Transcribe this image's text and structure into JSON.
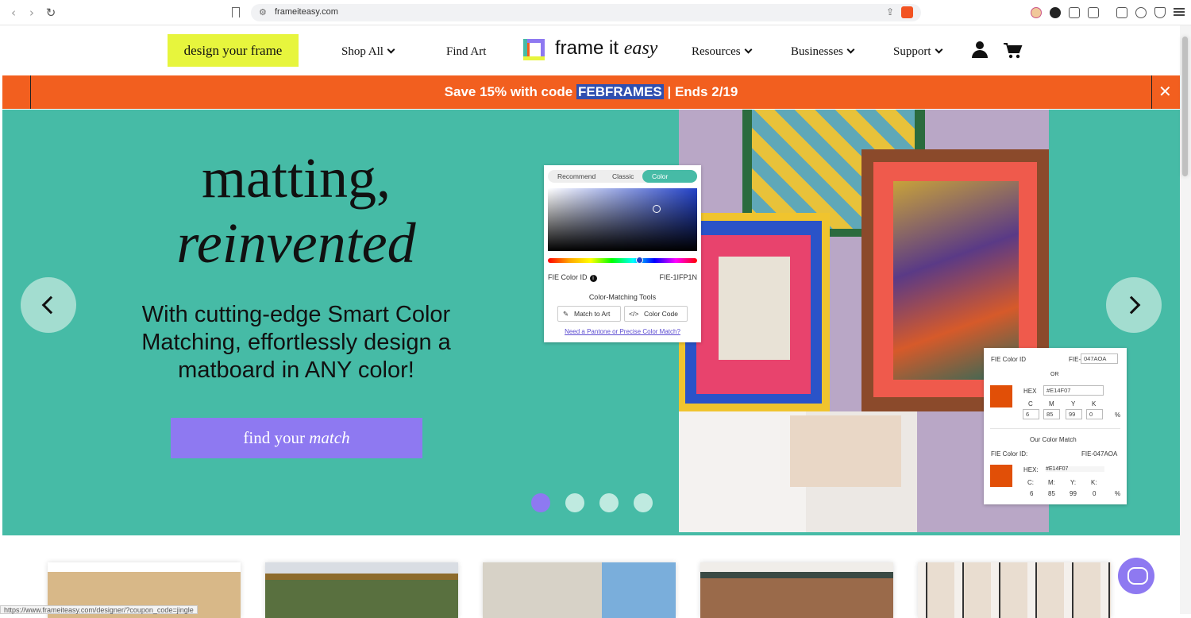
{
  "browser": {
    "url": "frameiteasy.com",
    "status_link": "https://www.frameiteasy.com/designer/?coupon_code=jingle"
  },
  "header": {
    "design_cta": "design your frame",
    "nav": {
      "shop_all": "Shop All",
      "find_art": "Find Art",
      "resources": "Resources",
      "businesses": "Businesses",
      "support": "Support"
    },
    "logo_text": "frame it",
    "logo_text_italic": "easy"
  },
  "promo": {
    "prefix": "Save 15% with code ",
    "code": "FEBFRAMES",
    "suffix": " | Ends 2/19",
    "close": "✕"
  },
  "hero": {
    "headline_line1": "matting,",
    "headline_line2": "reinvented",
    "subtitle": "With cutting-edge Smart Color Matching, effortlessly design a matboard in ANY color!",
    "cta_prefix": "find your ",
    "cta_italic": "match",
    "slides_total": 4,
    "active_slide": 1
  },
  "color_picker": {
    "tabs": [
      "Recommend",
      "Classic",
      "Color Picker"
    ],
    "active_tab": "Color Picker",
    "fie_label": "FIE Color ID",
    "fie_value": "FIE-1IFP1N",
    "tools_title": "Color-Matching Tools",
    "match_btn": "Match to Art",
    "code_btn": "Color Code",
    "pantone_link": "Need a Pantone or Precise Color Match?"
  },
  "color_match_card": {
    "fie_label": "FIE Color ID",
    "fie_prefix": "FIE-",
    "fie_input": "047AOA",
    "or": "OR",
    "hex_label": "HEX",
    "hex_input": "#E14F07",
    "cmyk_labels": [
      "C",
      "M",
      "Y",
      "K"
    ],
    "cmyk_values": [
      "6",
      "85",
      "99",
      "0"
    ],
    "pct": "%",
    "our_match_title": "Our Color Match",
    "our_fie_label": "FIE Color ID:",
    "our_fie_value": "FIE-047AOA",
    "our_hex_label": "HEX:",
    "our_hex_value": "#E14F07",
    "our_cmyk_labels": [
      "C:",
      "M:",
      "Y:",
      "K:"
    ],
    "our_cmyk_values": [
      "6",
      "85",
      "99",
      "0"
    ],
    "swatch_color": "#E14F07"
  },
  "colors": {
    "hero_bg": "#46bba6",
    "promo_bg": "#f25f1f",
    "accent_purple": "#8e79f1",
    "cta_yellow": "#e7f53d"
  }
}
